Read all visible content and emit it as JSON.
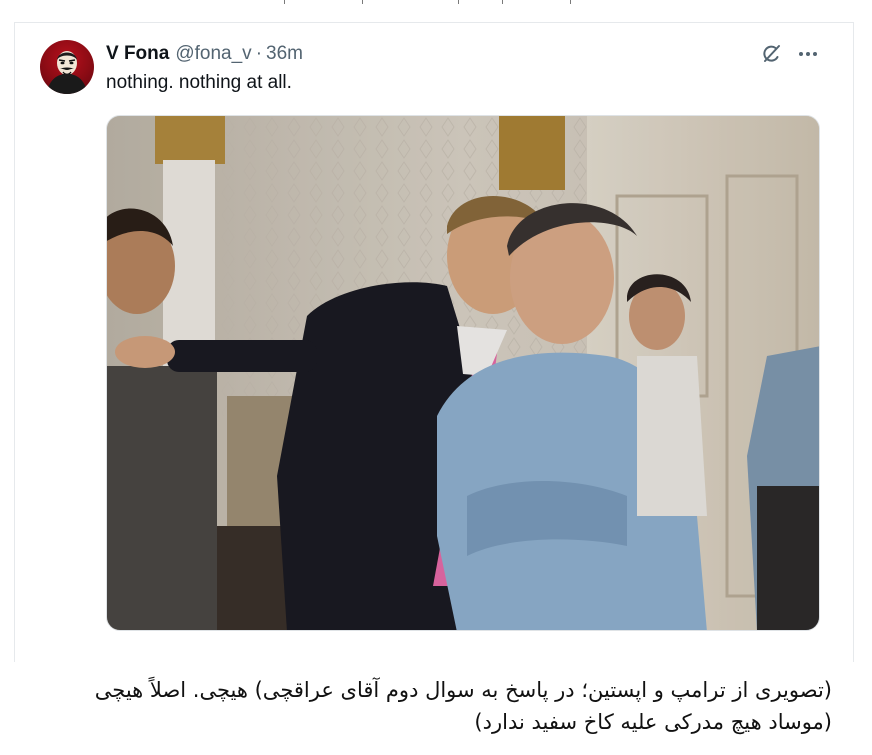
{
  "tweet": {
    "author": {
      "display_name": "V Fona",
      "handle": "@fona_v",
      "separator": "·",
      "time_ago": "36m",
      "avatar": "masked-avatar"
    },
    "text": "nothing. nothing at all.",
    "actions": {
      "grok_icon": "grok-icon",
      "more_icon": "more-icon"
    },
    "media": {
      "type": "photo",
      "image": "archival-photo"
    }
  },
  "caption": {
    "line1": "(تصویری از ترامپ و اپستین؛ در پاسخ به سوال دوم آقای عراقچی) هیچی. اصلاً هیچی",
    "line2": "(موساد هیچ مدرکی علیه کاخ سفید ندارد)"
  },
  "colors": {
    "text_primary": "#0f1419",
    "text_secondary": "#536471",
    "border": "#e6e9ec"
  }
}
